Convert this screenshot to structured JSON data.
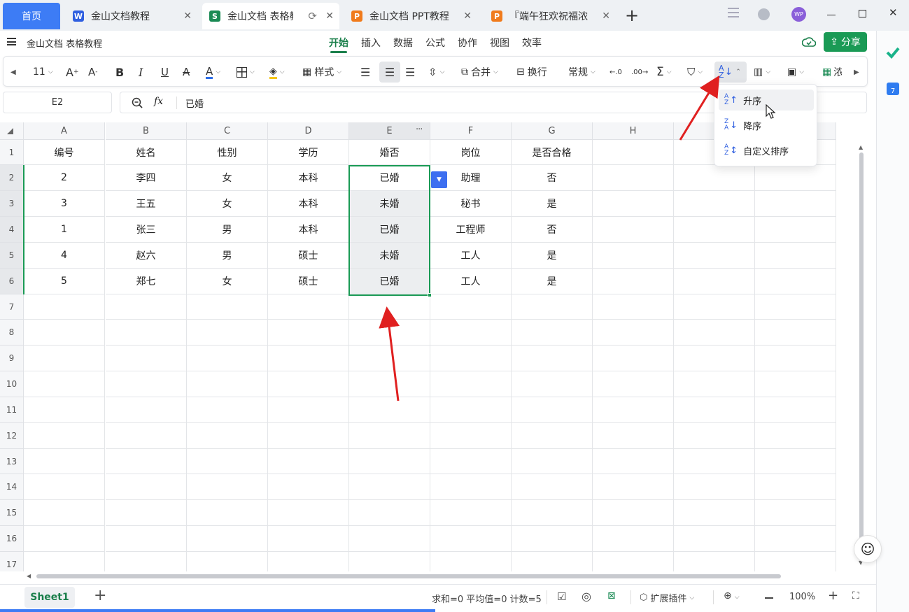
{
  "tabs": [
    {
      "label": "首页",
      "icon": "home-tab"
    },
    {
      "label": "金山文档教程",
      "icon": "word-doc-icon",
      "icon_letter": "W",
      "color": "#2f5fe0"
    },
    {
      "label": "金山文档 表格教程",
      "icon": "sheet-doc-icon",
      "icon_letter": "S",
      "color": "#1a8a54"
    },
    {
      "label": "金山文档 PPT教程",
      "icon": "ppt-doc-icon",
      "icon_letter": "P",
      "color": "#f07b1c"
    },
    {
      "label": "『端午狂欢祝福浓",
      "icon": "ppt-doc-icon",
      "icon_letter": "P",
      "color": "#f07b1c"
    }
  ],
  "window": {
    "avatar": "WP"
  },
  "doc": {
    "title": "金山文档 表格教程"
  },
  "menu": {
    "items": [
      "开始",
      "插入",
      "数据",
      "公式",
      "协作",
      "视图",
      "效率"
    ],
    "active": "开始"
  },
  "share": {
    "label": "分享"
  },
  "toolbar": {
    "font_size": "11",
    "style_label": "样式",
    "merge_label": "合并",
    "wrap_label": "换行",
    "format_label": "常规",
    "more_label": "浓"
  },
  "formula": {
    "cell_ref": "E2",
    "fx": "fx",
    "value": "已婚"
  },
  "columns": [
    "A",
    "B",
    "C",
    "D",
    "E",
    "F",
    "G",
    "H",
    "",
    ""
  ],
  "rows": [
    "1",
    "2",
    "3",
    "4",
    "5",
    "6",
    "7",
    "8",
    "9",
    "10",
    "11",
    "12",
    "13",
    "14",
    "15",
    "16",
    "17"
  ],
  "table": {
    "header": [
      "编号",
      "姓名",
      "性别",
      "学历",
      "婚否",
      "岗位",
      "是否合格"
    ],
    "data": [
      [
        "2",
        "李四",
        "女",
        "本科",
        "已婚",
        "助理",
        "否"
      ],
      [
        "3",
        "王五",
        "女",
        "本科",
        "未婚",
        "秘书",
        "是"
      ],
      [
        "1",
        "张三",
        "男",
        "本科",
        "已婚",
        "工程师",
        "否"
      ],
      [
        "4",
        "赵六",
        "男",
        "硕士",
        "未婚",
        "工人",
        "是"
      ],
      [
        "5",
        "郑七",
        "女",
        "硕士",
        "已婚",
        "工人",
        "是"
      ]
    ]
  },
  "sort_menu": {
    "items": [
      "升序",
      "降序",
      "自定义排序"
    ],
    "hovered": "升序"
  },
  "status": {
    "sheet_tab": "Sheet1",
    "summary": "求和=0 平均值=0 计数=5",
    "plugins_label": "扩展插件",
    "zoom": "100%"
  },
  "colors": {
    "accent_green": "#1a7f4b",
    "home_tab": "#3d7cf5",
    "selection": "#1a9a55",
    "annotation_arrow": "#e02020"
  }
}
